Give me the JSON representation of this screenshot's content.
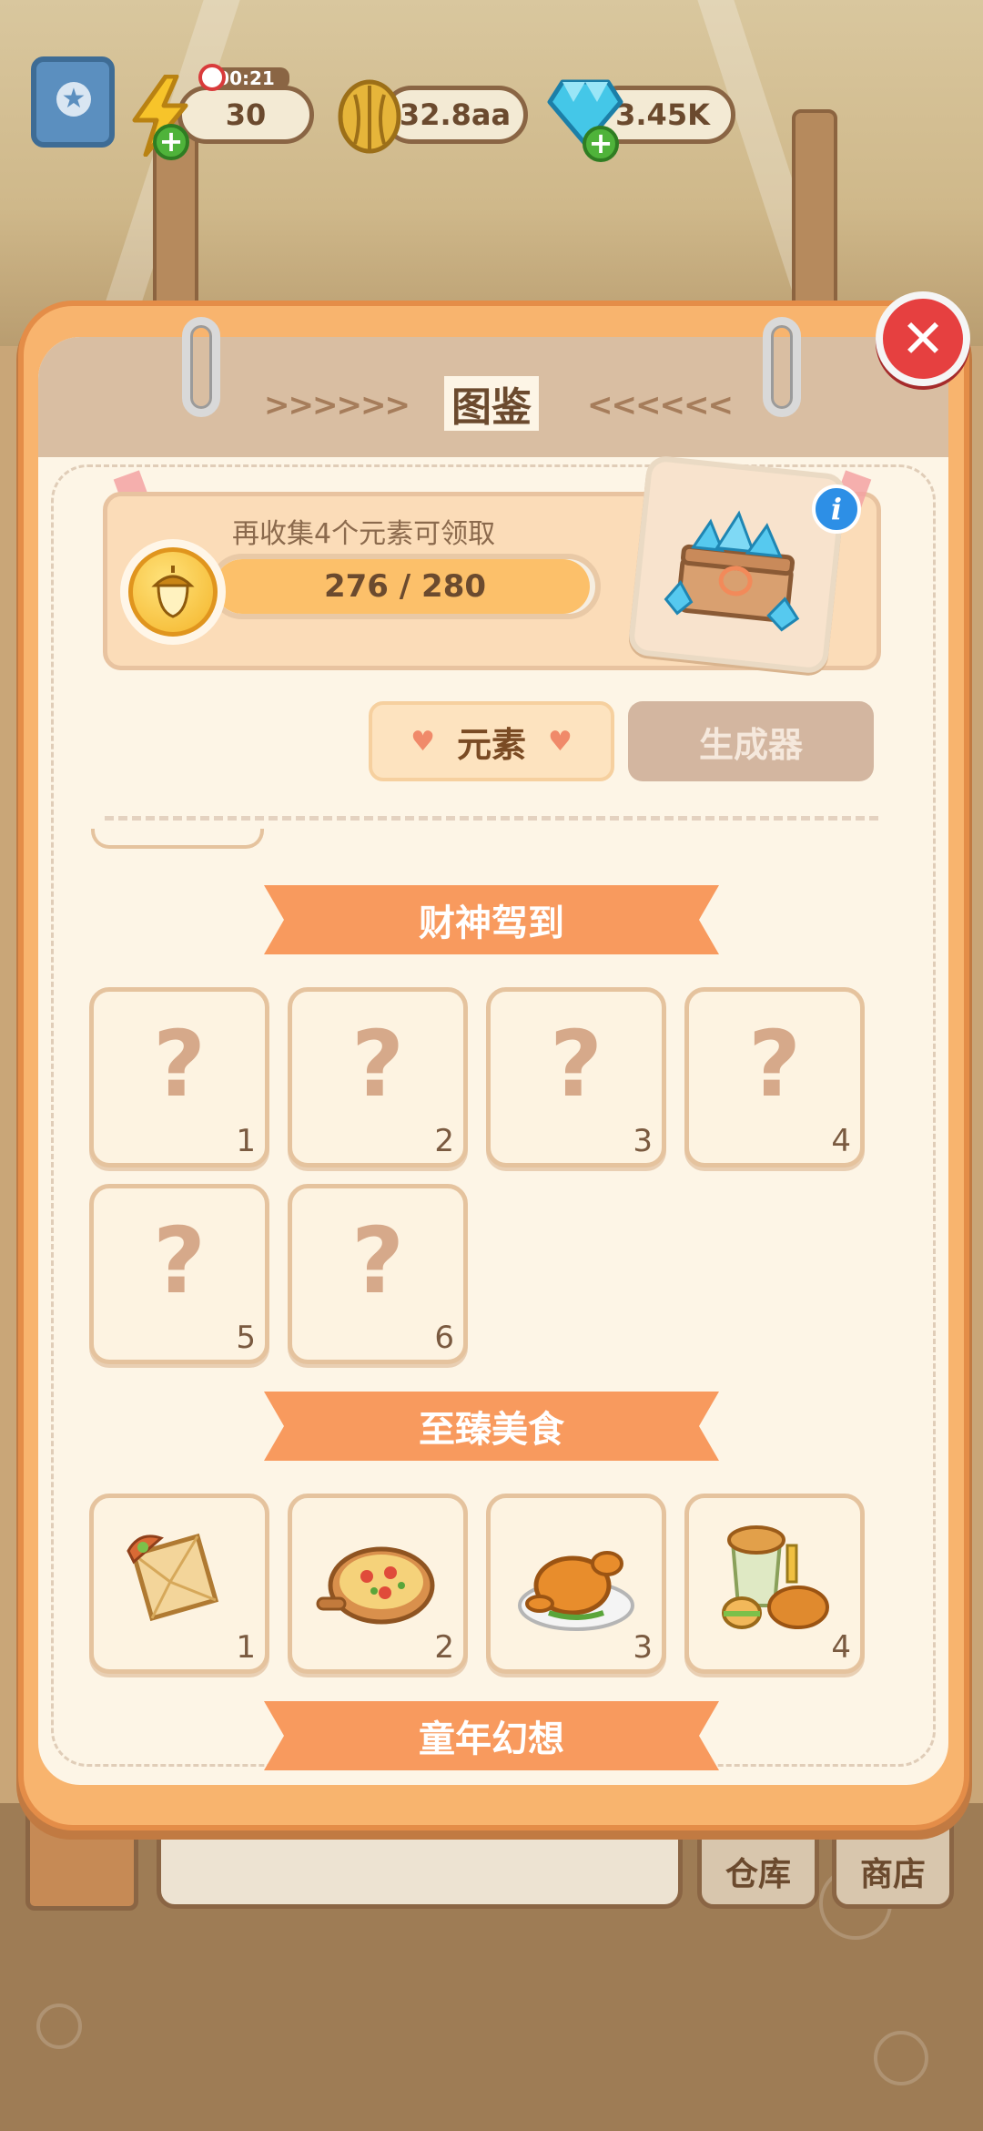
{
  "topbar": {
    "energy_timer": "00:21",
    "energy_value": "30",
    "coins_value": "32.8aa",
    "gems_value": "3.45K"
  },
  "book": {
    "title": "图鉴",
    "arrows_left": ">>>>>>",
    "arrows_right": "<<<<<<"
  },
  "reward": {
    "text": "再收集4个元素可领取",
    "progress_current": 276,
    "progress_total": 280,
    "progress_label": "276 / 280",
    "info_icon": "i"
  },
  "tabs": {
    "elements": "元素",
    "generators": "生成器"
  },
  "sections": [
    {
      "title": "财神驾到",
      "tiles": [
        {
          "num": "1",
          "locked": true,
          "q": "?"
        },
        {
          "num": "2",
          "locked": true,
          "q": "?"
        },
        {
          "num": "3",
          "locked": true,
          "q": "?"
        },
        {
          "num": "4",
          "locked": true,
          "q": "?"
        },
        {
          "num": "5",
          "locked": true,
          "q": "?"
        },
        {
          "num": "6",
          "locked": true,
          "q": "?"
        }
      ]
    },
    {
      "title": "至臻美食",
      "tiles": [
        {
          "num": "1",
          "icon": "sandwich-icon"
        },
        {
          "num": "2",
          "icon": "pizza-icon"
        },
        {
          "num": "3",
          "icon": "roast-chicken-icon"
        },
        {
          "num": "4",
          "icon": "fried-chicken-meal-icon"
        }
      ]
    },
    {
      "title": "童年幻想",
      "tiles": []
    }
  ],
  "bottom": {
    "warehouse": "仓库",
    "shop": "商店"
  },
  "colors": {
    "book_frame": "#f8b46e",
    "banner": "#f89a5e",
    "close": "#e64040",
    "progress_fill": "#fcc06a"
  }
}
